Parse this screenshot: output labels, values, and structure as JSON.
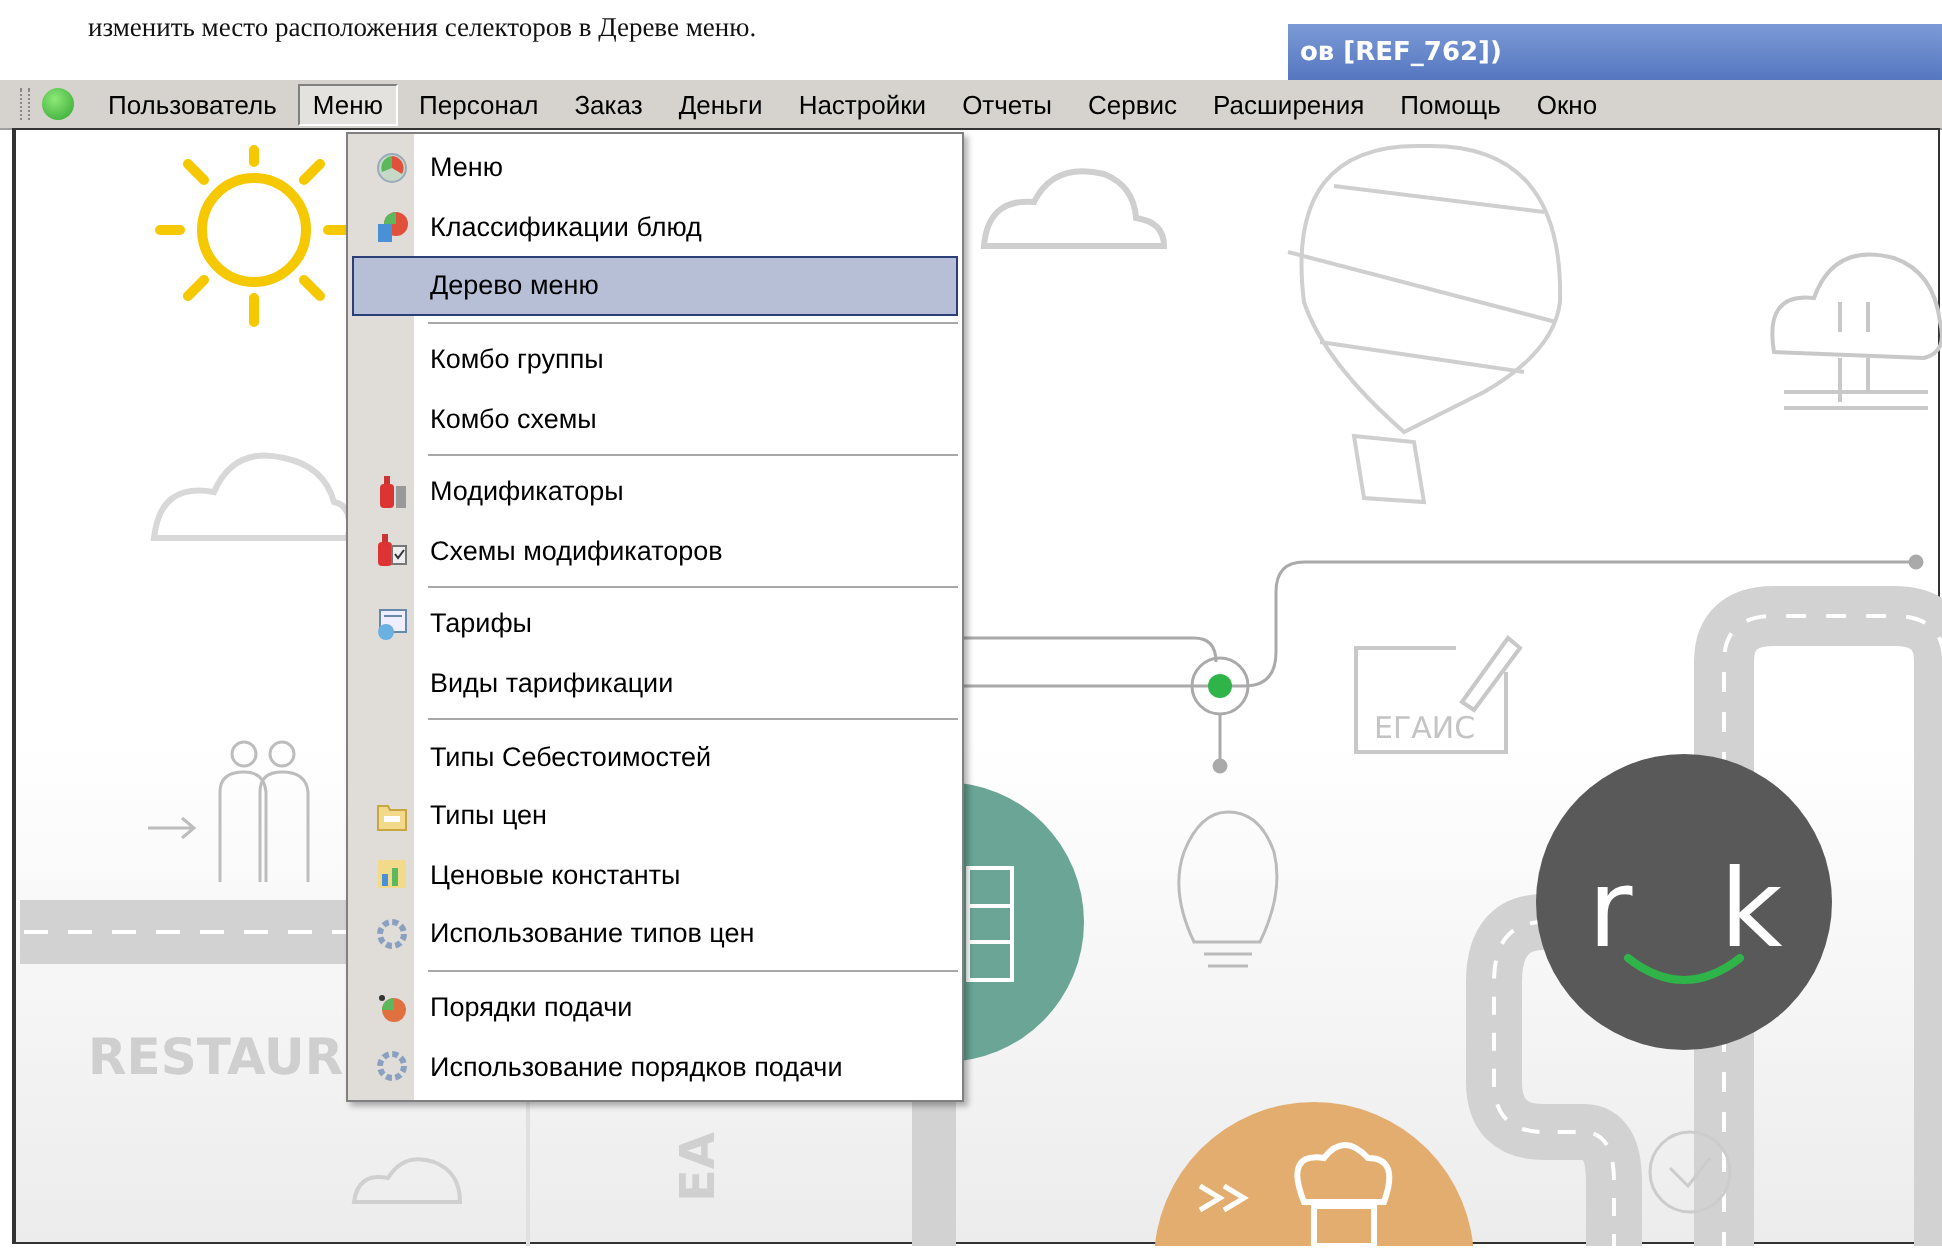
{
  "caption": "изменить место расположения селекторов в Дереве меню.",
  "window": {
    "title": "ов [REF_762])"
  },
  "menubar": [
    {
      "label": "Пользователь",
      "selected": false
    },
    {
      "label": "Меню",
      "selected": true
    },
    {
      "label": "Персонал",
      "selected": false
    },
    {
      "label": "Заказ",
      "selected": false
    },
    {
      "label": "Деньги",
      "selected": false
    },
    {
      "label": "Настройки",
      "selected": false
    },
    {
      "label": "Отчеты",
      "selected": false
    },
    {
      "label": "Сервис",
      "selected": false
    },
    {
      "label": "Расширения",
      "selected": false
    },
    {
      "label": "Помощь",
      "selected": false
    },
    {
      "label": "Окно",
      "selected": false
    }
  ],
  "dropdown": {
    "groups": [
      {
        "items": [
          {
            "label": "Меню",
            "kind": "pie",
            "selected": false
          },
          {
            "label": "Классификации блюд",
            "kind": "pie-doc",
            "selected": false
          },
          {
            "label": "Дерево меню",
            "selected": true
          }
        ]
      },
      {
        "items": [
          {
            "label": "Комбо группы",
            "selected": false
          },
          {
            "label": "Комбо схемы",
            "selected": false
          }
        ]
      },
      {
        "items": [
          {
            "label": "Модификаторы",
            "kind": "bottle",
            "selected": false
          },
          {
            "label": "Схемы модификаторов",
            "kind": "bottle-doc",
            "selected": false
          }
        ]
      },
      {
        "items": [
          {
            "label": "Тарифы",
            "kind": "tariff",
            "selected": false
          },
          {
            "label": "Виды тарификации",
            "selected": false
          }
        ]
      },
      {
        "items": [
          {
            "label": "Типы Себестоимостей",
            "selected": false
          },
          {
            "label": "Типы цен",
            "kind": "folder",
            "selected": false
          },
          {
            "label": "Ценовые константы",
            "kind": "chart",
            "selected": false
          },
          {
            "label": "Использование типов цен",
            "kind": "gear",
            "selected": false
          }
        ]
      },
      {
        "items": [
          {
            "label": "Порядки подачи",
            "kind": "order",
            "selected": false
          },
          {
            "label": "Использование порядков подачи",
            "kind": "gear",
            "selected": false
          }
        ]
      }
    ]
  },
  "illustration": {
    "egais": "ЕГАИС",
    "restaurant": "RESTAUR",
    "logo_left": "r",
    "logo_right": "k",
    "vertical": "EA"
  }
}
